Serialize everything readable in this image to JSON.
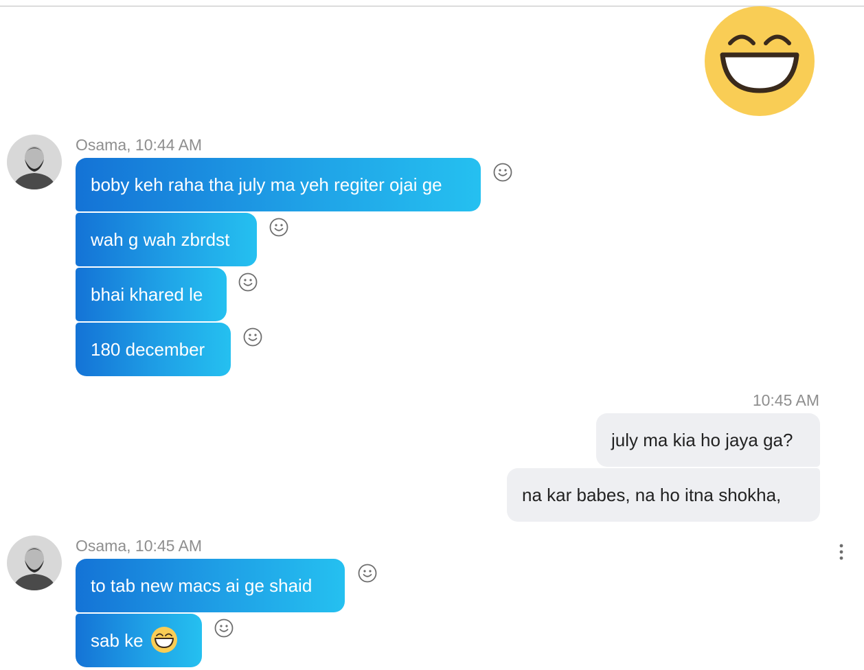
{
  "conversation": {
    "groups": [
      {
        "sender": "Osama",
        "time": "10:44 AM",
        "meta": "Osama, 10:44 AM",
        "messages": [
          "boby keh raha tha july ma yeh regiter ojai ge",
          "wah g wah zbrdst",
          "bhai khared le",
          "180 december"
        ]
      },
      {
        "sender": "me",
        "time": "10:45 AM",
        "meta": "10:45 AM",
        "messages": [
          "july ma kia ho jaya ga?",
          "na kar babes, na ho itna shokha,"
        ]
      },
      {
        "sender": "Osama",
        "time": "10:45 AM",
        "meta": "Osama, 10:45 AM",
        "messages": [
          "to tab new macs ai ge shaid",
          "sab ke"
        ]
      }
    ]
  },
  "icons": {
    "big_reaction": "grinning-face-emoji",
    "react": "smiley-react-icon",
    "more": "more-options-icon",
    "inline": "grinning-face-emoji"
  },
  "colors": {
    "incoming_start": "#1473d6",
    "incoming_end": "#25c0f0",
    "outgoing_bg": "#eeeff2",
    "meta_text": "#8e8e8e"
  }
}
